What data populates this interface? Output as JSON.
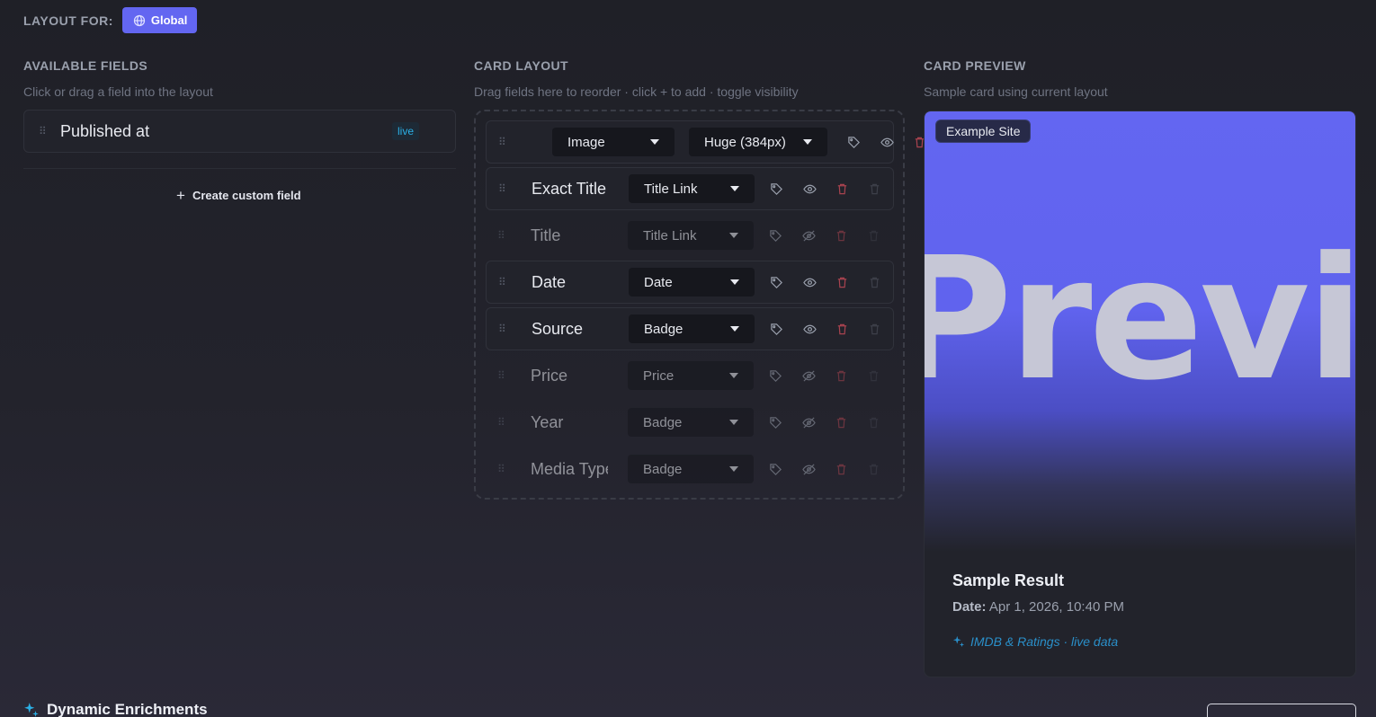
{
  "header": {
    "layout_for_label": "LAYOUT FOR:",
    "scope_button": "Global",
    "scope_icon": "globe-icon"
  },
  "available": {
    "title": "AVAILABLE FIELDS",
    "subtitle": "Click or drag a field into the layout",
    "fields": [
      {
        "label": "Published at",
        "badge": "live"
      }
    ],
    "create_label": "Create custom field"
  },
  "layout": {
    "title": "CARD LAYOUT",
    "subtitle": "Drag fields here to reorder · click + to add · toggle visibility",
    "image_row": {
      "type": "Image",
      "size": "Huge (384px)"
    },
    "rows": [
      {
        "label": "Exact Title",
        "format": "Title Link",
        "visible": true
      },
      {
        "label": "Title",
        "format": "Title Link",
        "visible": false
      },
      {
        "label": "Date",
        "format": "Date",
        "visible": true
      },
      {
        "label": "Source",
        "format": "Badge",
        "visible": true
      },
      {
        "label": "Price",
        "format": "Price",
        "visible": false
      },
      {
        "label": "Year",
        "format": "Badge",
        "visible": false
      },
      {
        "label": "Media Type",
        "format": "Badge",
        "visible": false
      }
    ]
  },
  "preview": {
    "title": "CARD PREVIEW",
    "subtitle": "Sample card using current layout",
    "image_text": "Preview",
    "site_badge": "Example Site",
    "sample_title": "Sample Result",
    "date_label": "Date:",
    "date_value": "Apr 1, 2026, 10:40 PM",
    "enrichment_link": "IMDB & Ratings · live data"
  },
  "bottom": {
    "section_title": "Dynamic Enrichments"
  },
  "colors": {
    "accent": "#6366f1",
    "live": "#2bb0e6",
    "danger": "#e05260",
    "link": "#2a8fc9"
  }
}
